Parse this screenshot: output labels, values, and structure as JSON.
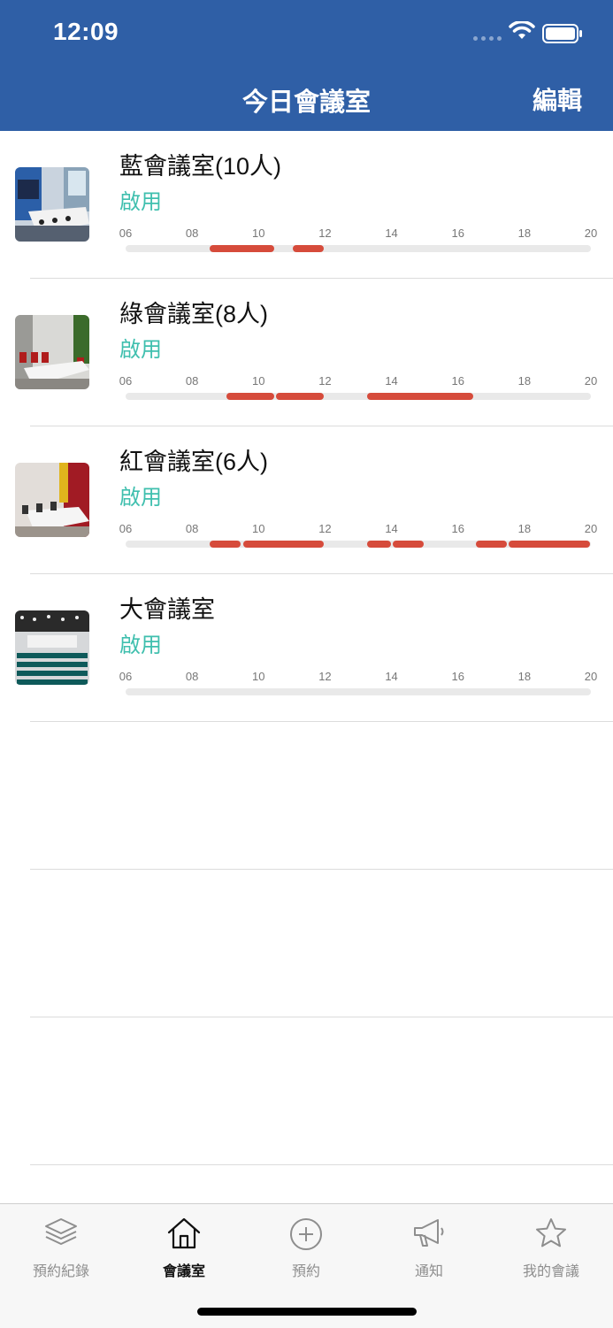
{
  "status_bar": {
    "time": "12:09"
  },
  "nav": {
    "title": "今日會議室",
    "edit_label": "編輯"
  },
  "hours": [
    "06",
    "08",
    "10",
    "12",
    "14",
    "16",
    "18",
    "20"
  ],
  "rooms": [
    {
      "name": "藍會議室(10人)",
      "status": "啟用",
      "thumb": "blue",
      "bookings": [
        [
          8.5,
          10.5
        ],
        [
          11,
          12
        ]
      ]
    },
    {
      "name": "綠會議室(8人)",
      "status": "啟用",
      "thumb": "green",
      "bookings": [
        [
          9,
          10.5
        ],
        [
          10.5,
          12
        ],
        [
          13.25,
          16.5
        ]
      ]
    },
    {
      "name": "紅會議室(6人)",
      "status": "啟用",
      "thumb": "red",
      "bookings": [
        [
          8.5,
          9.5
        ],
        [
          9.5,
          12
        ],
        [
          13.25,
          14
        ],
        [
          14,
          15
        ],
        [
          16.5,
          17.5
        ],
        [
          17.5,
          20
        ]
      ]
    },
    {
      "name": "大會議室",
      "status": "啟用",
      "thumb": "large",
      "bookings": []
    }
  ],
  "tabs": [
    {
      "label": "預約紀錄",
      "icon": "layers-icon",
      "active": false
    },
    {
      "label": "會議室",
      "icon": "home-icon",
      "active": true
    },
    {
      "label": "預約",
      "icon": "plus-circle-icon",
      "active": false
    },
    {
      "label": "通知",
      "icon": "megaphone-icon",
      "active": false
    },
    {
      "label": "我的會議",
      "icon": "star-icon",
      "active": false
    }
  ],
  "colors": {
    "header": "#2f5fa6",
    "status": "#3fbfae",
    "booking": "#d64b3b",
    "track": "#e9e9e9"
  }
}
